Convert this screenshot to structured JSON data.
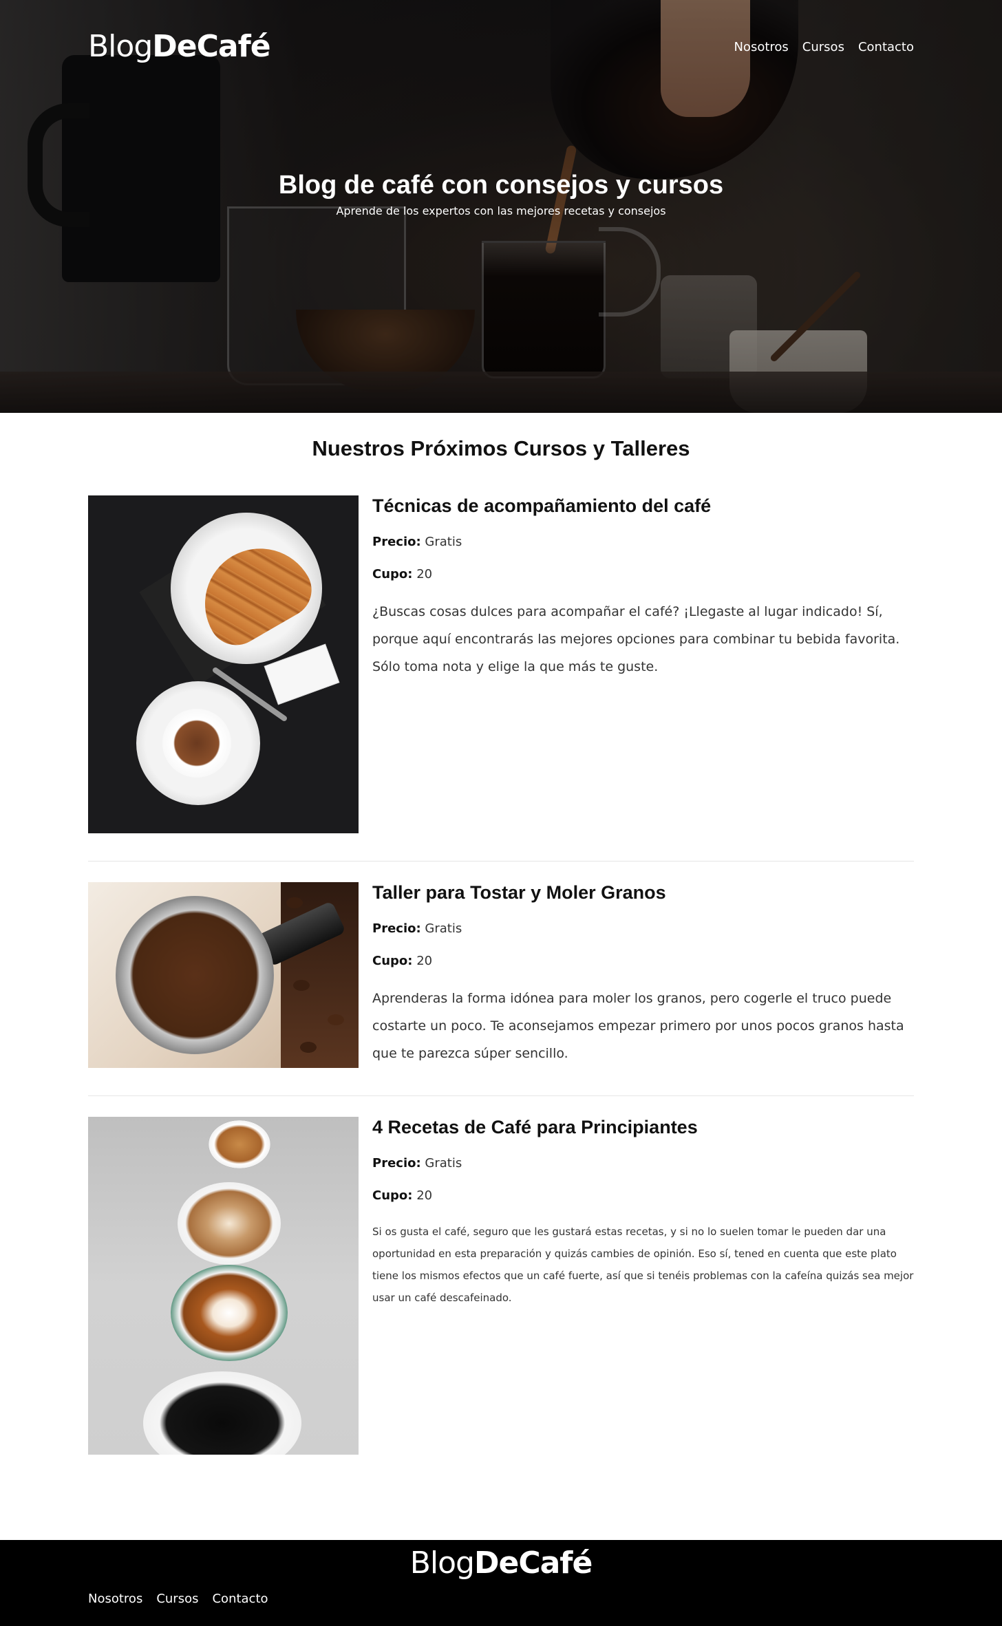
{
  "brand": {
    "light": "Blog",
    "bold": "DeCafé"
  },
  "nav": [
    {
      "label": "Nosotros"
    },
    {
      "label": "Cursos"
    },
    {
      "label": "Contacto"
    }
  ],
  "hero": {
    "title": "Blog de café con consejos y cursos",
    "subtitle": "Aprende de los expertos con las mejores recetas y consejos"
  },
  "section": {
    "title": "Nuestros Próximos Cursos y Talleres"
  },
  "labels": {
    "price": "Precio:",
    "slots": "Cupo:"
  },
  "courses": [
    {
      "title": "Técnicas de acompañamiento del café",
      "price": "Gratis",
      "slots": "20",
      "description": "¿Buscas cosas dulces para acompañar el café? ¡Llegaste al lugar indicado! Sí, porque aquí encontrarás las mejores opciones para combinar tu bebida favorita. Sólo toma nota y elige la que más te guste."
    },
    {
      "title": "Taller para Tostar y Moler Granos",
      "price": "Gratis",
      "slots": "20",
      "description": "Aprenderas la forma idónea para moler los granos, pero cogerle el truco puede costarte un poco. Te aconsejamos empezar primero por unos pocos granos hasta que te parezca súper sencillo."
    },
    {
      "title": "4 Recetas de Café para Principiantes",
      "price": "Gratis",
      "slots": "20",
      "description": "Si os gusta el café, seguro que les gustará estas recetas, y si no lo suelen tomar le pueden dar una oportunidad en esta preparación y quizás cambies de opinión. Eso sí, tened en cuenta que este plato tiene los mismos efectos que un café fuerte, así que si tenéis problemas con la cafeína quizás sea mejor usar un café descafeinado."
    }
  ],
  "colors": {
    "footer_bg": "#000000",
    "text": "#111111",
    "hero_text": "#ffffff"
  },
  "icons": {
    "course_images": [
      "croissant-espresso-photo",
      "portafilter-ground-coffee-photo",
      "four-coffee-cups-photo"
    ]
  }
}
